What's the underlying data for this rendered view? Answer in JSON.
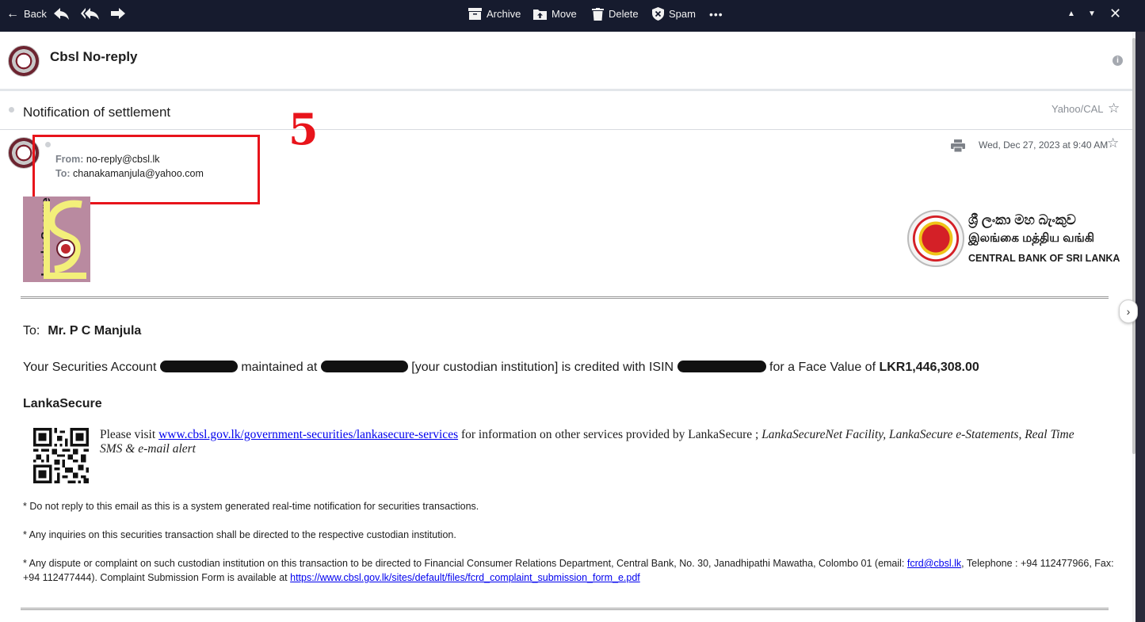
{
  "toolbar": {
    "back": "Back",
    "archive": "Archive",
    "move": "Move",
    "delete": "Delete",
    "spam": "Spam",
    "more": "•••"
  },
  "sender": {
    "name": "Cbsl No-reply"
  },
  "subject": {
    "text": "Notification of settlement",
    "folder": "Yahoo/CAL"
  },
  "message": {
    "from_label": "From:",
    "from": "no-reply@cbsl.lk",
    "to_label": "To:",
    "to": "chanakamanjula@yahoo.com",
    "date": "Wed, Dec 27, 2023 at 9:40 AM"
  },
  "annotation": {
    "number": "5",
    "color": "#e8141b"
  },
  "logos": {
    "lankasecure": "LankaSecure",
    "cb_sinhala": "ශ්‍රී ලංකා මහ බැංකුව",
    "cb_tamil": "இலங்கை மத்திய வங்கி",
    "cb_english": "CENTRAL BANK OF SRI LANKA"
  },
  "body": {
    "to_label": "To:",
    "to_name": "Mr. P C Manjula",
    "account_1": "Your Securities Account",
    "account_2": "maintained at",
    "account_3": "[your custodian institution] is credited with ISIN",
    "account_4": "for a Face Value of",
    "face_value": "LKR1,446,308.00",
    "heading": "LankaSecure",
    "visit_1": "Please visit",
    "visit_link": "www.cbsl.gov.lk/government-securities/lankasecure-services",
    "visit_2": "for information on other services provided by LankaSecure ;",
    "visit_italic": "LankaSecureNet Facility, LankaSecure e-Statements, Real Time SMS & e-mail alert",
    "note1": "* Do not reply to this email as this is a system generated real-time notification for securities transactions.",
    "note2": "* Any inquiries on this securities transaction shall be directed to the respective custodian institution.",
    "note3_1": "* Any dispute or complaint on such custodian institution on this transaction to be directed to Financial Consumer Relations Department, Central Bank, No. 30, Janadhipathi Mawatha, Colombo 01 (email:",
    "note3_email": "fcrd@cbsl.lk",
    "note3_2": ", Telephone : +94 112477966, Fax: +94 112477444). Complaint Submission Form is available at",
    "note3_link": "https://www.cbsl.gov.lk/sites/default/files/fcrd_complaint_submission_form_e.pdf"
  }
}
